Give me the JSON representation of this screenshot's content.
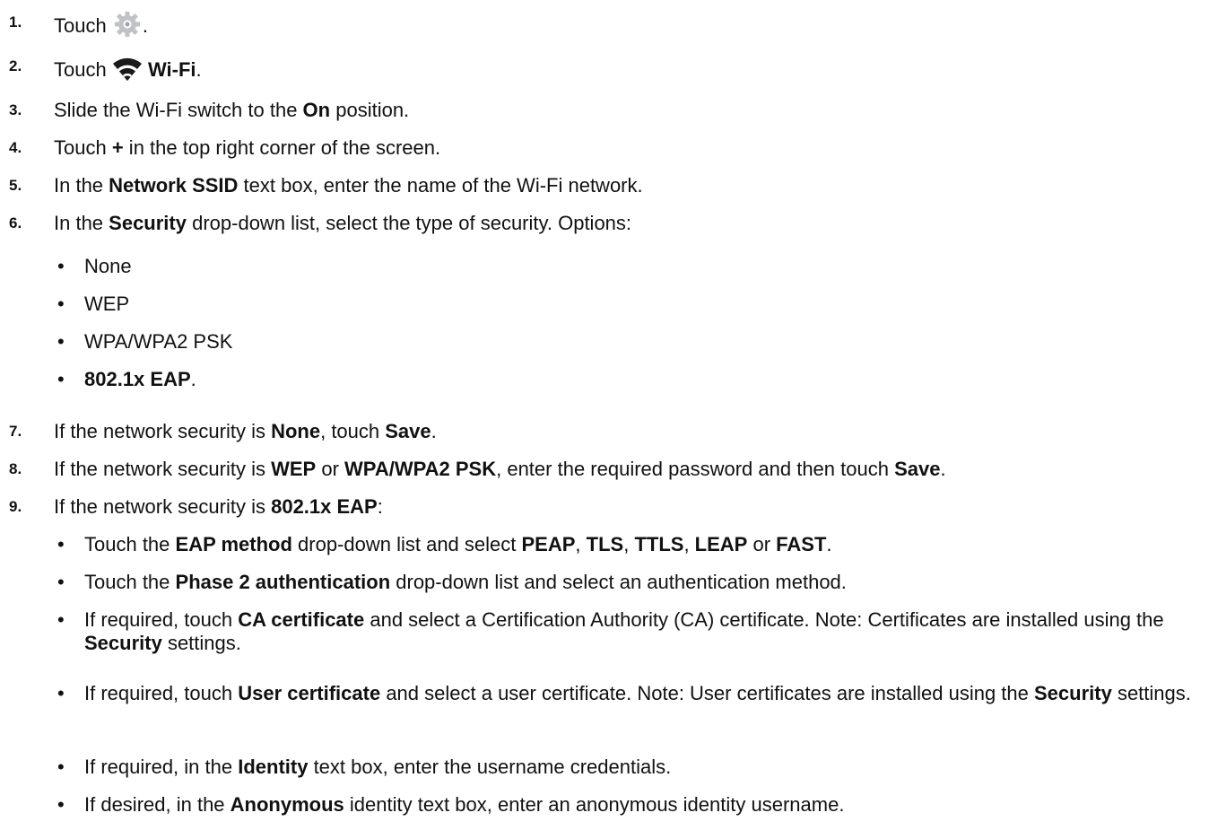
{
  "steps": [
    {
      "num": "1.",
      "segments": [
        {
          "t": "Touch "
        },
        {
          "icon": "settings-gear-icon"
        },
        {
          "t": "."
        }
      ]
    },
    {
      "num": "2.",
      "segments": [
        {
          "t": "Touch "
        },
        {
          "icon": "wifi-icon"
        },
        {
          "t": " "
        },
        {
          "t": "Wi-Fi",
          "b": true
        },
        {
          "t": "."
        }
      ]
    },
    {
      "num": "3.",
      "segments": [
        {
          "t": "Slide the Wi-Fi switch to the "
        },
        {
          "t": "On",
          "b": true
        },
        {
          "t": " position."
        }
      ]
    },
    {
      "num": "4.",
      "segments": [
        {
          "t": "Touch "
        },
        {
          "t": "+",
          "b": true
        },
        {
          "t": " in the top right corner of the screen."
        }
      ]
    },
    {
      "num": "5.",
      "segments": [
        {
          "t": "In the "
        },
        {
          "t": "Network SSID",
          "b": true
        },
        {
          "t": " text box, enter the name of the Wi-Fi network."
        }
      ]
    },
    {
      "num": "6.",
      "segments": [
        {
          "t": "In the "
        },
        {
          "t": "Security",
          "b": true
        },
        {
          "t": " drop-down list, select the type of security. Options:"
        }
      ]
    },
    {
      "num": "7.",
      "segments": [
        {
          "t": "If the network security is "
        },
        {
          "t": "None",
          "b": true
        },
        {
          "t": ", touch "
        },
        {
          "t": "Save",
          "b": true
        },
        {
          "t": "."
        }
      ]
    },
    {
      "num": "8.",
      "segments": [
        {
          "t": "If the network security is "
        },
        {
          "t": "WEP",
          "b": true
        },
        {
          "t": " or "
        },
        {
          "t": "WPA/WPA2 PSK",
          "b": true
        },
        {
          "t": ", enter the required password and then touch "
        },
        {
          "t": "Save",
          "b": true
        },
        {
          "t": "."
        }
      ]
    },
    {
      "num": "9.",
      "segments": [
        {
          "t": "If the network security is "
        },
        {
          "t": "802.1x EAP",
          "b": true
        },
        {
          "t": ":"
        }
      ]
    }
  ],
  "security_options": [
    [
      {
        "t": "None"
      }
    ],
    [
      {
        "t": "WEP"
      }
    ],
    [
      {
        "t": "WPA/WPA2 PSK"
      }
    ],
    [
      {
        "t": "802.1x EAP",
        "b": true
      },
      {
        "t": "."
      }
    ]
  ],
  "eap_bullets": [
    [
      {
        "t": "Touch the "
      },
      {
        "t": "EAP method",
        "b": true
      },
      {
        "t": " drop-down list and select "
      },
      {
        "t": "PEAP",
        "b": true
      },
      {
        "t": ", "
      },
      {
        "t": "TLS",
        "b": true
      },
      {
        "t": ", "
      },
      {
        "t": "TTLS",
        "b": true
      },
      {
        "t": ", "
      },
      {
        "t": "LEAP",
        "b": true
      },
      {
        "t": " or "
      },
      {
        "t": "FAST",
        "b": true
      },
      {
        "t": "."
      }
    ],
    [
      {
        "t": "Touch the "
      },
      {
        "t": "Phase 2 authentication",
        "b": true
      },
      {
        "t": " drop-down list and select an authentication method."
      }
    ],
    [
      {
        "t": "If required, touch "
      },
      {
        "t": "CA certificate",
        "b": true
      },
      {
        "t": " and select a Certification Authority (CA) certificate. Note: Certificates are installed using the "
      },
      {
        "t": "Security",
        "b": true
      },
      {
        "t": " settings."
      }
    ],
    [
      {
        "t": "If required, touch "
      },
      {
        "t": "User certificate",
        "b": true
      },
      {
        "t": " and select a user certificate. Note: User certificates are installed using the "
      },
      {
        "t": "Security",
        "b": true
      },
      {
        "t": " settings."
      }
    ],
    [
      {
        "t": "If required, in the "
      },
      {
        "t": "Identity",
        "b": true
      },
      {
        "t": " text box, enter the username credentials."
      }
    ],
    [
      {
        "t": "If desired, in the "
      },
      {
        "t": "Anonymous",
        "b": true
      },
      {
        "t": " identity text box, enter an anonymous identity username."
      }
    ]
  ],
  "bullet_char": "•"
}
